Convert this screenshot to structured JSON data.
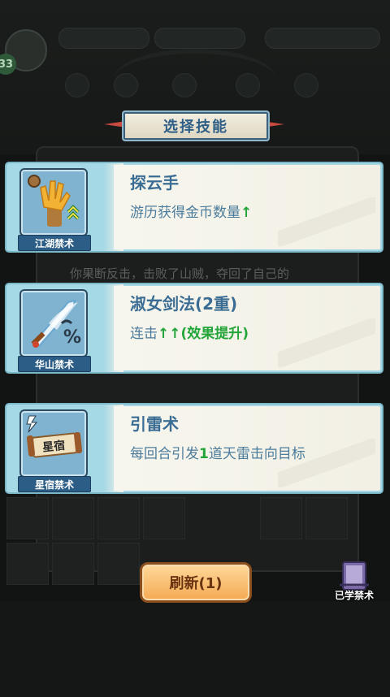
{
  "background": {
    "level": "33",
    "middle_text": "你果断反击，击败了山贼，夺回了自己的"
  },
  "title": "选择技能",
  "skills": [
    {
      "name": "探云手",
      "icon": "golden-hand-icon",
      "category": "江湖禁术",
      "desc_prefix": "游历获得金币数量",
      "desc_arrows": "↑",
      "desc_suffix": ""
    },
    {
      "name": "淑女剑法(2重)",
      "icon": "flaming-sword-icon",
      "category": "华山禁术",
      "desc_prefix": "连击",
      "desc_arrows": "↑↑(效果提升)",
      "desc_suffix": ""
    },
    {
      "name": "引雷术",
      "icon": "thunder-scroll-icon",
      "category": "星宿禁术",
      "desc_prefix": "每回合引发",
      "desc_arrows": "1",
      "desc_suffix": "道天雷击向目标"
    }
  ],
  "scroll_text": "星宿",
  "refresh_label": "刷新(1)",
  "learned_label": "已学禁术",
  "colors": {
    "card_blue": "#a6d9e6",
    "name_blue": "#3a6c94",
    "caption_blue": "#2b5d86",
    "green": "#23a53a",
    "refresh_orange": "#f4a953"
  }
}
